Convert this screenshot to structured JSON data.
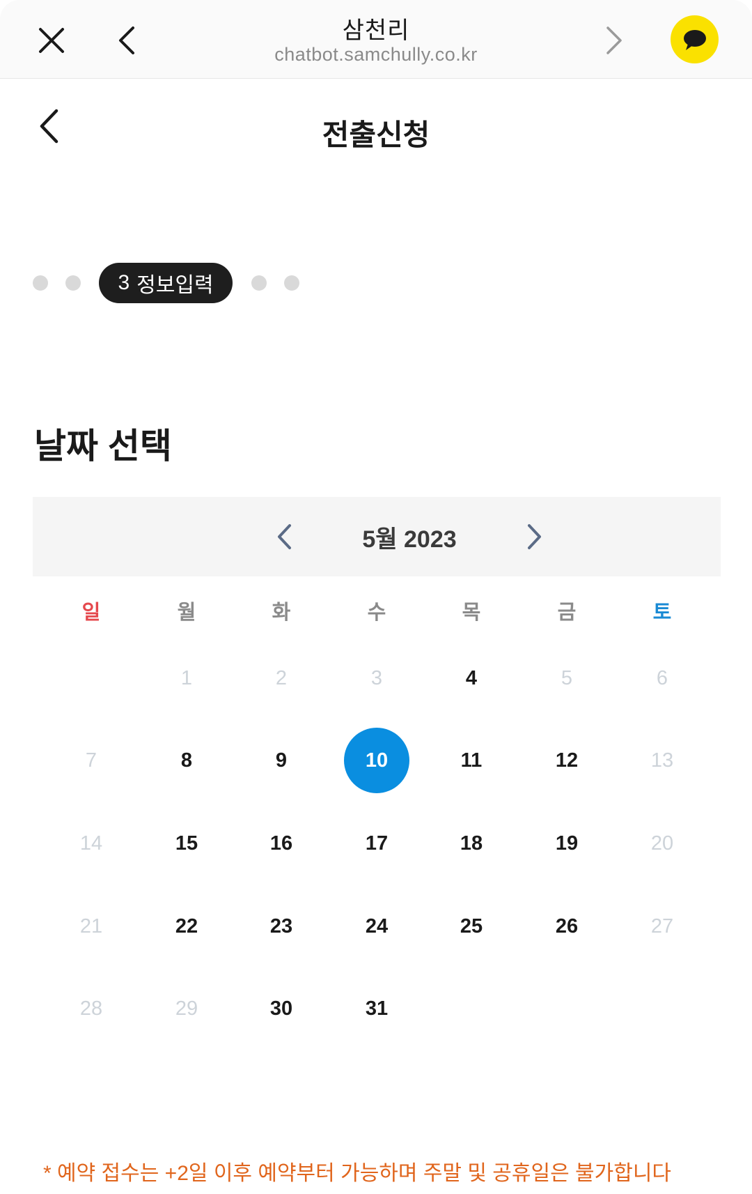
{
  "browser": {
    "title": "삼천리",
    "url": "chatbot.samchully.co.kr"
  },
  "page": {
    "title": "전출신청"
  },
  "steps": {
    "active_number": "3",
    "active_label": "정보입력"
  },
  "section": {
    "title": "날짜 선택"
  },
  "calendar": {
    "month_label": "5월 2023",
    "weekdays": [
      "일",
      "월",
      "화",
      "수",
      "목",
      "금",
      "토"
    ],
    "selected_day": "10",
    "weeks": [
      [
        "",
        "1",
        "2",
        "3",
        "4",
        "5",
        "6"
      ],
      [
        "7",
        "8",
        "9",
        "10",
        "11",
        "12",
        "13"
      ],
      [
        "14",
        "15",
        "16",
        "17",
        "18",
        "19",
        "20"
      ],
      [
        "21",
        "22",
        "23",
        "24",
        "25",
        "26",
        "27"
      ],
      [
        "28",
        "29",
        "30",
        "31",
        "",
        "",
        ""
      ]
    ],
    "available_days": [
      "4",
      "8",
      "9",
      "10",
      "11",
      "12",
      "15",
      "16",
      "17",
      "18",
      "19",
      "22",
      "23",
      "24",
      "25",
      "26",
      "30",
      "31"
    ]
  },
  "notice": "* 예약 접수는 +2일 이후 예약부터 가능하며 주말 및 공휴일은 불가합니다",
  "colors": {
    "accent": "#0a8ee0",
    "kakao": "#fae100",
    "sunday": "#e5484d",
    "saturday": "#1a8ad4",
    "notice": "#e0651c"
  }
}
